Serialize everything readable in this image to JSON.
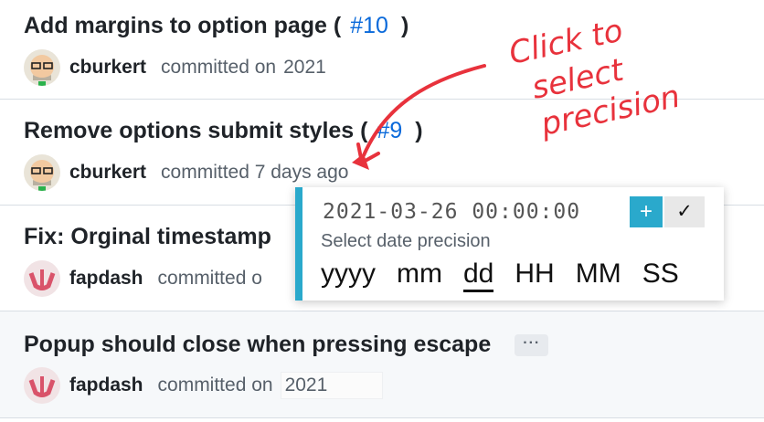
{
  "commits": [
    {
      "title": "Add margins to option page (",
      "pr": "#10",
      "close": ")",
      "author": "cburkert",
      "committed": "committed on",
      "date": "2021"
    },
    {
      "title": "Remove options submit styles (",
      "pr": "#9",
      "close": ")",
      "author": "cburkert",
      "committed": "committed 7 days ago",
      "date": ""
    },
    {
      "title": "Fix: Orginal timestamp",
      "pr": "",
      "close": "",
      "author": "fapdash",
      "committed": "committed o",
      "date": ""
    },
    {
      "title": "Popup should close when pressing escape",
      "pr": "",
      "close": "",
      "author": "fapdash",
      "committed": "committed on",
      "date": "2021",
      "more": "···"
    }
  ],
  "popup": {
    "timestamp": "2021-03-26 00:00:00",
    "plus": "+",
    "confirm": "✓",
    "hint": "Select date precision",
    "precisions": [
      "yyyy",
      "mm",
      "dd",
      "HH",
      "MM",
      "SS"
    ],
    "selected": "dd"
  },
  "annotation": {
    "line1": "Click to",
    "line2": "select",
    "line3": "precision",
    "color": "#e8323c"
  },
  "colors": {
    "accent": "#2aa9cc",
    "link": "#0969da"
  }
}
